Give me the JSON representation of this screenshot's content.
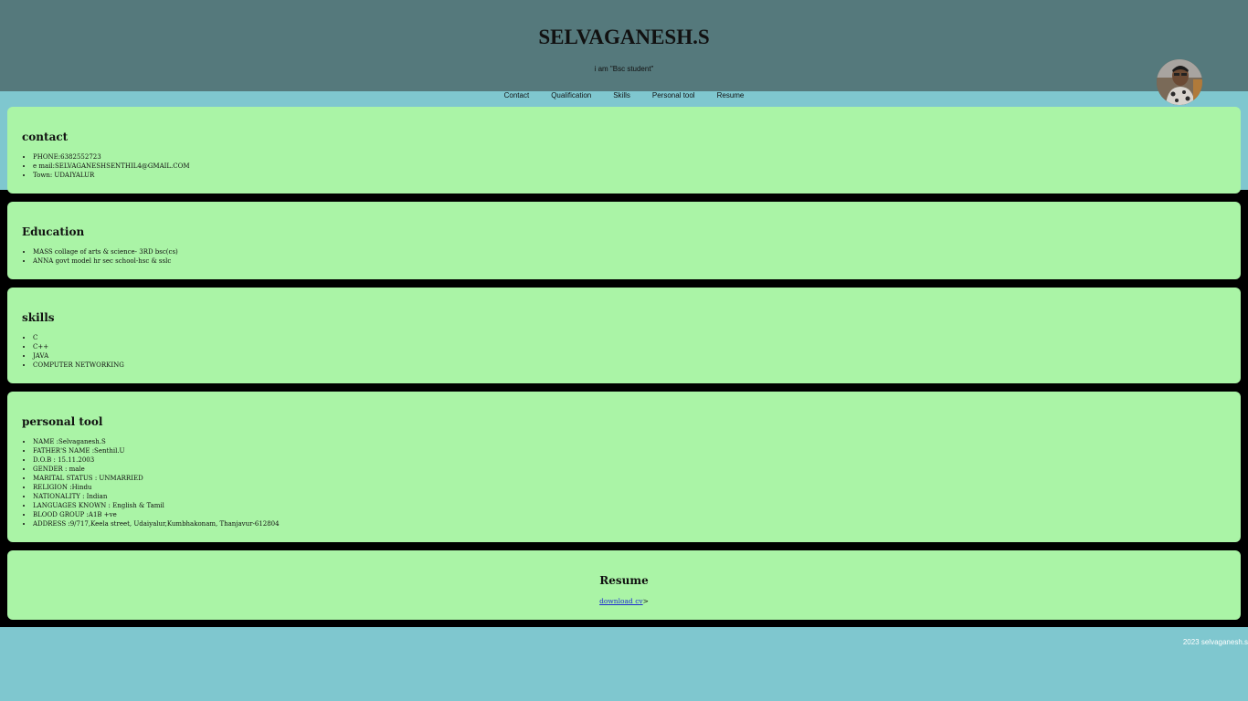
{
  "header": {
    "title": "SELVAGANESH.S",
    "tagline": "i am \"Bsc student\""
  },
  "nav": [
    "Contact",
    "Qualification",
    "Skills",
    "Personal tool",
    "Resume"
  ],
  "contact": {
    "heading": "contact",
    "items": [
      "PHONE:6382552723",
      "e mail:SELVAGANESHSENTHIL4@GMAIL.COM",
      "Town: UDAIYALUR"
    ]
  },
  "education": {
    "heading": "Education",
    "items": [
      "MASS collage of arts & science- 3RD bsc(cs)",
      "ANNA govt model hr sec school-hsc & sslc"
    ]
  },
  "skills": {
    "heading": "skills",
    "items": [
      "C",
      "C++",
      "JAVA",
      "COMPUTER NETWORKING"
    ]
  },
  "personal": {
    "heading": "personal tool",
    "items": [
      "NAME :Selvaganesh.S",
      "FATHER'S NAME :Senthil.U",
      "D.O.B : 15.11.2003",
      "GENDER : male",
      "MARITAL STATUS : UNMARRIED",
      "RELIGION :Hindu",
      "NATIONALITY : Indian",
      "LANGUAGES KNOWN : English & Tamil",
      "BLOOD GROUP :A1B +ve",
      "ADDRESS :9/717,Keela street, Udaiyalur,Kumbhakonam, Thanjavur-612804"
    ]
  },
  "resume": {
    "heading": "Resume",
    "link_label": "download cv",
    "link_suffix": ">"
  },
  "footer": {
    "text": "2023 selvaganesh.s"
  },
  "colors": {
    "header_bg": "#55797c",
    "page_bg": "#7fc7cf",
    "card_bg": "#aaf4a6",
    "strip_bg": "#000000",
    "link": "#1e2bd0"
  }
}
